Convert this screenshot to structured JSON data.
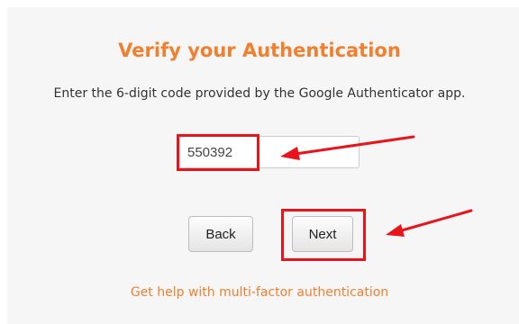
{
  "verify": {
    "title": "Verify your Authentication",
    "instructions": "Enter the 6-digit code provided by the Google Authenticator app.",
    "code_value": "550392",
    "back_label": "Back",
    "next_label": "Next",
    "help_link": "Get help with multi-factor authentication"
  },
  "annotations": {
    "highlight_color": "#e8141b"
  },
  "colors": {
    "accent": "#f07f2e",
    "card_background": "#f6f6f6"
  }
}
